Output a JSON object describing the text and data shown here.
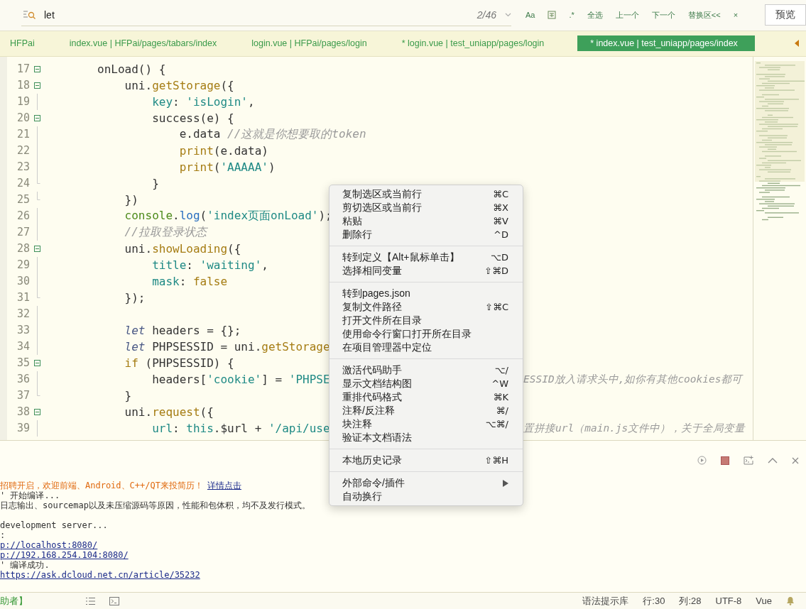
{
  "search": {
    "value": "let",
    "count": "2/46",
    "options": [
      {
        "kind": "text",
        "text": "Aa"
      },
      {
        "kind": "word-icon"
      },
      {
        "kind": "text",
        "text": ".*"
      },
      {
        "kind": "text",
        "text": "全选"
      },
      {
        "kind": "text",
        "text": "上一个"
      },
      {
        "kind": "text",
        "text": "下一个"
      },
      {
        "kind": "text",
        "text": "替换区<<"
      },
      {
        "kind": "text",
        "text": "×"
      }
    ],
    "preview": "预览"
  },
  "tabs": [
    {
      "label": "HFPai",
      "selected": false
    },
    {
      "label": "index.vue | HFPai/pages/tabars/index",
      "selected": false
    },
    {
      "label": "login.vue | HFPai/pages/login",
      "selected": false
    },
    {
      "label": "* login.vue | test_uniapp/pages/login",
      "selected": false
    },
    {
      "label": "* index.vue | test_uniapp/pages/index",
      "selected": true
    }
  ],
  "code": [
    {
      "number": "17",
      "kind": "fold-start",
      "tokens": [
        {
          "kind": "plain",
          "text": "        onLoad() {"
        }
      ]
    },
    {
      "number": "18",
      "kind": "fold-start",
      "tokens": [
        {
          "kind": "plain",
          "text": "            uni."
        },
        {
          "kind": "func",
          "text": "getStorage"
        },
        {
          "kind": "plain",
          "text": "({"
        }
      ]
    },
    {
      "number": "19",
      "kind": "line",
      "tokens": [
        {
          "kind": "key",
          "text": "                key"
        },
        {
          "kind": "plain",
          "text": ": "
        },
        {
          "kind": "string",
          "text": "'isLogin'"
        },
        {
          "kind": "plain",
          "text": ","
        }
      ]
    },
    {
      "number": "20",
      "kind": "fold-start",
      "tokens": [
        {
          "kind": "plain",
          "text": "                success(e) {"
        }
      ]
    },
    {
      "number": "21",
      "kind": "line",
      "tokens": [
        {
          "kind": "plain",
          "text": "                    e.data "
        },
        {
          "kind": "comment",
          "text": "//这就是你想要取的token"
        }
      ]
    },
    {
      "number": "22",
      "kind": "line",
      "tokens": [
        {
          "kind": "func",
          "text": "                    print"
        },
        {
          "kind": "plain",
          "text": "(e.data)"
        }
      ]
    },
    {
      "number": "23",
      "kind": "line",
      "tokens": [
        {
          "kind": "func",
          "text": "                    print"
        },
        {
          "kind": "plain",
          "text": "("
        },
        {
          "kind": "string",
          "text": "'AAAAA'"
        },
        {
          "kind": "plain",
          "text": ")"
        }
      ]
    },
    {
      "number": "24",
      "kind": "fold-end",
      "tokens": [
        {
          "kind": "plain",
          "text": "                }"
        }
      ]
    },
    {
      "number": "25",
      "kind": "fold-end",
      "tokens": [
        {
          "kind": "plain",
          "text": "            })"
        }
      ]
    },
    {
      "number": "26",
      "kind": "line",
      "tokens": [
        {
          "kind": "object",
          "text": "            console"
        },
        {
          "kind": "plain",
          "text": "."
        },
        {
          "kind": "method",
          "text": "log"
        },
        {
          "kind": "plain",
          "text": "("
        },
        {
          "kind": "string",
          "text": "'index页面onLoad'"
        },
        {
          "kind": "plain",
          "text": ");"
        }
      ]
    },
    {
      "number": "27",
      "kind": "line",
      "tokens": [
        {
          "kind": "comment",
          "text": "            //拉取登录状态"
        }
      ]
    },
    {
      "number": "28",
      "kind": "fold-start",
      "tokens": [
        {
          "kind": "plain",
          "text": "            uni."
        },
        {
          "kind": "func",
          "text": "showLoading"
        },
        {
          "kind": "plain",
          "text": "({"
        }
      ]
    },
    {
      "number": "29",
      "kind": "line",
      "tokens": [
        {
          "kind": "key",
          "text": "                title"
        },
        {
          "kind": "plain",
          "text": ": "
        },
        {
          "kind": "string",
          "text": "'waiting'"
        },
        {
          "kind": "plain",
          "text": ","
        }
      ]
    },
    {
      "number": "30",
      "kind": "line",
      "tokens": [
        {
          "kind": "key",
          "text": "                mask"
        },
        {
          "kind": "plain",
          "text": ": "
        },
        {
          "kind": "func",
          "text": "false"
        }
      ]
    },
    {
      "number": "31",
      "kind": "fold-end",
      "tokens": [
        {
          "kind": "plain",
          "text": "            });"
        }
      ]
    },
    {
      "number": "32",
      "kind": "line"
    },
    {
      "number": "33",
      "kind": "line",
      "tokens": [
        {
          "kind": "keyword",
          "text": "            let"
        },
        {
          "kind": "plain",
          "text": " headers = {};"
        }
      ]
    },
    {
      "number": "34",
      "kind": "line",
      "tokens": [
        {
          "kind": "keyword",
          "text": "            let"
        },
        {
          "kind": "plain",
          "text": " PHPSESSID = uni."
        },
        {
          "kind": "func",
          "text": "getStorage"
        }
      ]
    },
    {
      "number": "35",
      "kind": "fold-start",
      "tokens": [
        {
          "kind": "func",
          "text": "            if"
        },
        {
          "kind": "plain",
          "text": " (PHPSESSID) {"
        }
      ]
    },
    {
      "number": "36",
      "kind": "line",
      "tokens": [
        {
          "kind": "plain",
          "text": "                headers["
        },
        {
          "kind": "string",
          "text": "'cookie'"
        },
        {
          "kind": "plain",
          "text": "] = "
        },
        {
          "kind": "string",
          "text": "'PHPSE"
        }
      ],
      "tail": "ESSID放入请求头中,如你有其他cookies都可"
    },
    {
      "number": "37",
      "kind": "fold-end",
      "tokens": [
        {
          "kind": "plain",
          "text": "            }"
        }
      ]
    },
    {
      "number": "38",
      "kind": "fold-start",
      "tokens": [
        {
          "kind": "plain",
          "text": "            uni."
        },
        {
          "kind": "func",
          "text": "request"
        },
        {
          "kind": "plain",
          "text": "({"
        }
      ]
    },
    {
      "number": "39",
      "kind": "line",
      "tokens": [
        {
          "kind": "key",
          "text": "                url"
        },
        {
          "kind": "plain",
          "text": ": "
        },
        {
          "kind": "string",
          "text": "this"
        },
        {
          "kind": "plain",
          "text": ".$url + "
        },
        {
          "kind": "string",
          "text": "'/api/use"
        }
      ],
      "tail": "置拼接url（main.js文件中），关于全局变量"
    }
  ],
  "menu": [
    {
      "items": [
        {
          "label": "复制选区或当前行",
          "shortcut": "⌘C"
        },
        {
          "label": "剪切选区或当前行",
          "shortcut": "⌘X"
        },
        {
          "label": "粘贴",
          "shortcut": "⌘V"
        },
        {
          "label": "删除行",
          "shortcut": "^D"
        }
      ]
    },
    {
      "items": [
        {
          "label": "转到定义【Alt+鼠标单击】",
          "shortcut": "⌥D"
        },
        {
          "label": "选择相同变量",
          "shortcut": "⇧⌘D"
        }
      ]
    },
    {
      "items": [
        {
          "label": "转到pages.json"
        },
        {
          "label": "复制文件路径",
          "shortcut": "⇧⌘C"
        },
        {
          "label": "打开文件所在目录"
        },
        {
          "label": "使用命令行窗口打开所在目录"
        },
        {
          "label": "在项目管理器中定位"
        }
      ]
    },
    {
      "items": [
        {
          "label": "激活代码助手",
          "shortcut": "⌥/"
        },
        {
          "label": "显示文档结构图",
          "shortcut": "^W"
        },
        {
          "label": "重排代码格式",
          "shortcut": "⌘K"
        },
        {
          "label": "注释/反注释",
          "shortcut": "⌘/"
        },
        {
          "label": "块注释",
          "shortcut": "⌥⌘/"
        },
        {
          "label": "验证本文档语法"
        }
      ]
    },
    {
      "items": [
        {
          "label": "本地历史记录",
          "shortcut": "⇧⌘H"
        }
      ]
    },
    {
      "items": [
        {
          "label": "外部命令/插件",
          "submenu": true
        },
        {
          "label": "自动换行"
        }
      ]
    }
  ],
  "console": [
    {
      "kind": "notice",
      "text": "招聘开启，欢迎前端、Android、C++/QT来投简历！",
      "link": "详情点击"
    },
    {
      "kind": "text",
      "text": "' 开始编译..."
    },
    {
      "kind": "text",
      "text": "日志输出、sourcemap以及未压缩源码等原因，性能和包体积，均不及发行模式。"
    },
    {
      "kind": "gap"
    },
    {
      "kind": "text",
      "text": "development server..."
    },
    {
      "kind": "text",
      "text": ":"
    },
    {
      "kind": "link",
      "text": "p://localhost:8080/"
    },
    {
      "kind": "link",
      "text": "p://192.168.254.104:8080/"
    },
    {
      "kind": "text",
      "text": "' 编译成功."
    },
    {
      "kind": "link",
      "text": "https://ask.dcloud.net.cn/article/35232"
    }
  ],
  "status_bar": {
    "left": "助者】",
    "right": [
      "语法提示库",
      "行:30",
      "列:28",
      "UTF-8",
      "Vue"
    ]
  }
}
